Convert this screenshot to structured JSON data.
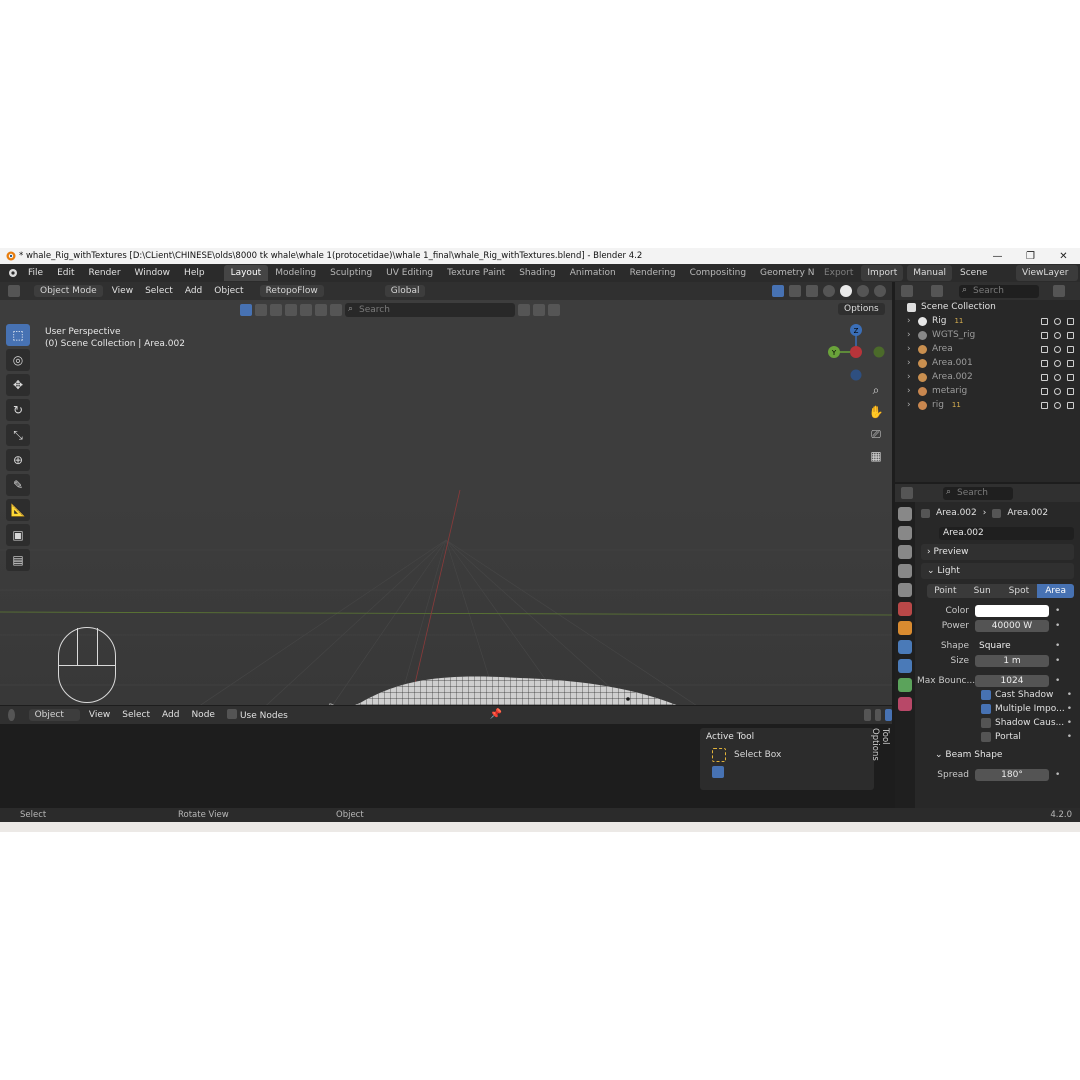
{
  "window": {
    "title": "* whale_Rig_withTextures [D:\\CLient\\CHINESE\\olds\\8000 tk whale\\whale 1(protocetidae)\\whale 1_final\\whale_Rig_withTextures.blend] - Blender 4.2",
    "controls": [
      "—",
      "❐",
      "✕"
    ]
  },
  "menu": {
    "items": [
      "File",
      "Edit",
      "Render",
      "Window",
      "Help"
    ],
    "workspaces": [
      "Layout",
      "Modeling",
      "Sculpting",
      "UV Editing",
      "Texture Paint",
      "Shading",
      "Animation",
      "Rendering",
      "Compositing",
      "Geometry N"
    ],
    "active_workspace": "Layout",
    "export": "Export",
    "import": "Import",
    "manual": "Manual",
    "scene": "Scene",
    "view_layer": "ViewLayer"
  },
  "viewport": {
    "mode": "Object Mode",
    "menus": [
      "View",
      "Select",
      "Add",
      "Object"
    ],
    "addon": "RetopoFlow",
    "transform": "Global",
    "search_placeholder": "Search",
    "options": "Options",
    "info_line1": "User Perspective",
    "info_line2": "(0) Scene Collection | Area.002",
    "gizmo_axes": [
      "Z",
      "Y"
    ]
  },
  "node_editor": {
    "type": "Object",
    "menus": [
      "View",
      "Select",
      "Add",
      "Node"
    ],
    "use_nodes": "Use Nodes",
    "active_tool_title": "Active Tool",
    "active_tool_name": "Select Box",
    "side_tabs": [
      "Tool",
      "Options"
    ]
  },
  "status": {
    "select": "Select",
    "rotate": "Rotate View",
    "object": "Object",
    "version": "4.2.0"
  },
  "outliner": {
    "search_placeholder": "Search",
    "root": "Scene Collection",
    "items": [
      {
        "name": "Rig",
        "dim": false,
        "color": "#e7e7e7",
        "badge": "11"
      },
      {
        "name": "WGTS_rig",
        "dim": true,
        "color": "#888888",
        "badge": ""
      },
      {
        "name": "Area",
        "dim": true,
        "color": "#c98f4f",
        "badge": ""
      },
      {
        "name": "Area.001",
        "dim": true,
        "color": "#c98f4f",
        "badge": ""
      },
      {
        "name": "Area.002",
        "dim": true,
        "color": "#c98f4f",
        "badge": ""
      },
      {
        "name": "metarig",
        "dim": true,
        "color": "#c9874f",
        "badge": ""
      },
      {
        "name": "rig",
        "dim": true,
        "color": "#c9874f",
        "badge": "11"
      }
    ]
  },
  "properties": {
    "search_placeholder": "Search",
    "breadcrumb_object": "Area.002",
    "breadcrumb_data": "Area.002",
    "data_name": "Area.002",
    "preview": "Preview",
    "light_panel": "Light",
    "light_types": [
      "Point",
      "Sun",
      "Spot",
      "Area"
    ],
    "active_light_type": "Area",
    "fields": [
      {
        "label": "Color",
        "value": "",
        "kind": "color"
      },
      {
        "label": "Power",
        "value": "40000 W",
        "kind": "num"
      },
      {
        "label": "Shape",
        "value": "Square",
        "kind": "enum"
      },
      {
        "label": "Size",
        "value": "1 m",
        "kind": "num"
      },
      {
        "label": "Max Bounc...",
        "value": "1024",
        "kind": "num"
      }
    ],
    "checks": [
      {
        "label": "Cast Shadow",
        "on": true
      },
      {
        "label": "Multiple Impo...",
        "on": true
      },
      {
        "label": "Shadow Caus...",
        "on": false
      },
      {
        "label": "Portal",
        "on": false
      }
    ],
    "beam_panel": "Beam Shape",
    "spread_label": "Spread",
    "spread_value": "180°"
  },
  "colors": {
    "accent": "#4772b3",
    "background": "#1d1d1d",
    "viewport": "#3d3d3d"
  }
}
